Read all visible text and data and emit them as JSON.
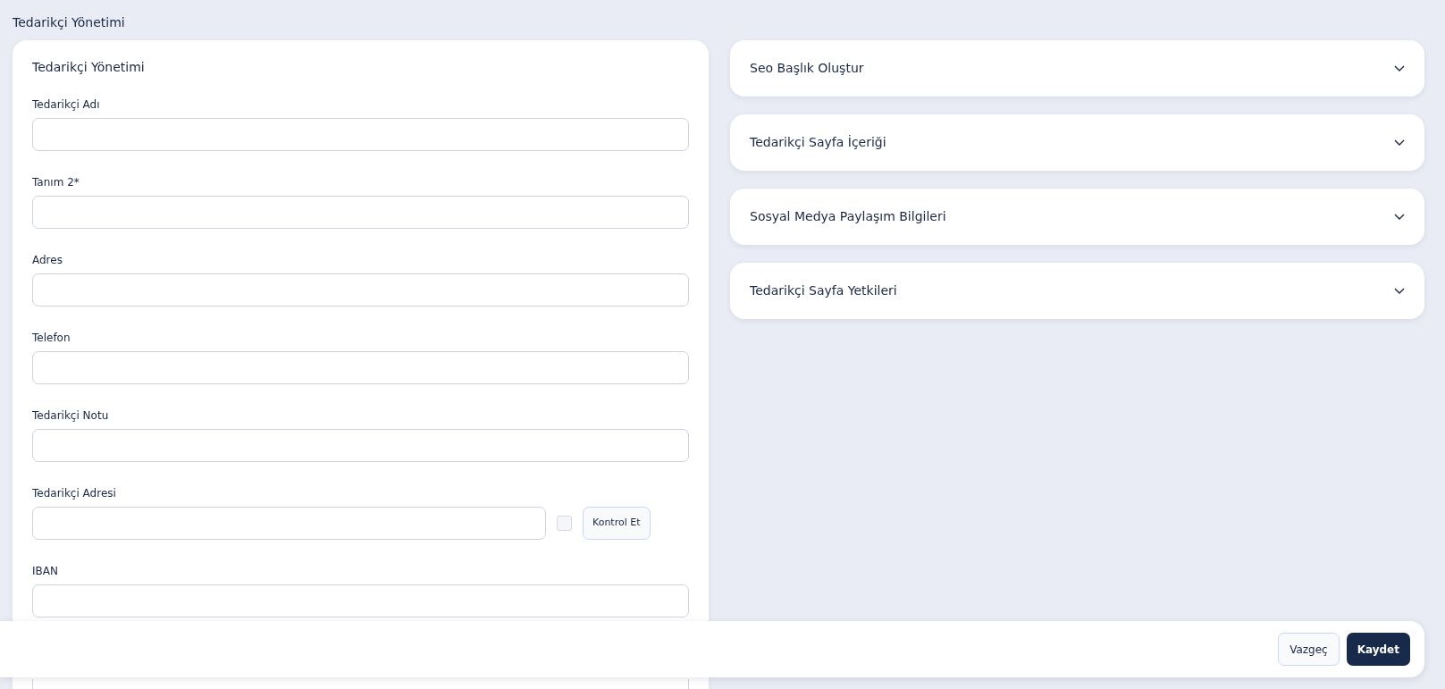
{
  "page_title": "Tedarikçi Yönetimi",
  "form": {
    "title": "Tedarikçi Yönetimi",
    "fields": [
      {
        "kind": "text",
        "label": "Tedarikçi Adı"
      },
      {
        "kind": "text",
        "label": "Tanım 2*"
      },
      {
        "kind": "text",
        "label": "Adres"
      },
      {
        "kind": "text",
        "label": "Telefon"
      },
      {
        "kind": "text",
        "label": "Tedarikçi Notu"
      },
      {
        "kind": "check",
        "label": "Tedarikçi Adresi",
        "checked": false,
        "button": "Kontrol Et"
      },
      {
        "kind": "text",
        "label": "IBAN"
      },
      {
        "kind": "text"
      }
    ]
  },
  "accordion": [
    {
      "title": "Seo Başlık Oluştur",
      "expanded": false
    },
    {
      "title": "Tedarikçi Sayfa İçeriği",
      "expanded": false
    },
    {
      "title": "Sosyal Medya Paylaşım Bilgileri",
      "expanded": false
    },
    {
      "title": "Tedarikçi Sayfa Yetkileri",
      "expanded": false
    }
  ],
  "footer": {
    "buttons": [
      {
        "label": "Vazgeç",
        "kind": "secondary"
      },
      {
        "label": "Kaydet",
        "kind": "primary"
      }
    ]
  }
}
